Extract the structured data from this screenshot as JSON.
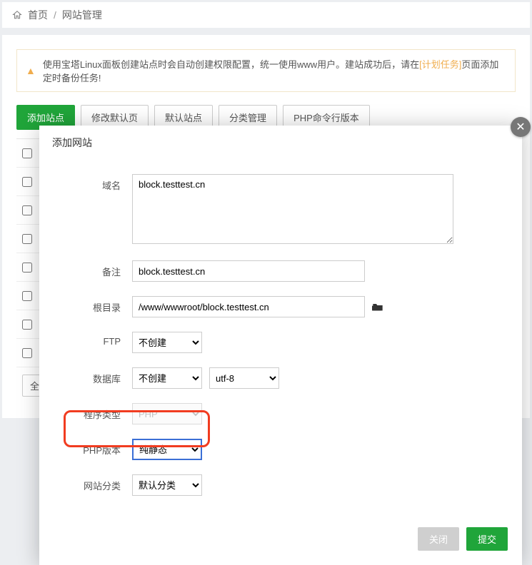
{
  "breadcrumb": {
    "home": "首页",
    "current": "网站管理"
  },
  "alert": {
    "prefix": "使用宝塔Linux面板创建站点时会自动创建权限配置，统一使用www用户。建站成功后，请在",
    "link": "[计划任务]",
    "suffix": "页面添加定时备份任务!"
  },
  "toolbar": {
    "add": "添加站点",
    "modify_default": "修改默认页",
    "default_site": "默认站点",
    "category": "分类管理",
    "php_cli": "PHP命令行版本"
  },
  "list_footer": "全部",
  "modal": {
    "title": "添加网站",
    "labels": {
      "domain": "域名",
      "remark": "备注",
      "root": "根目录",
      "ftp": "FTP",
      "database": "数据库",
      "program": "程序类型",
      "php": "PHP版本",
      "category": "网站分类"
    },
    "values": {
      "domain": "block.testtest.cn",
      "remark": "block.testtest.cn",
      "root": "/www/wwwroot/block.testtest.cn",
      "ftp": "不创建",
      "database": "不创建",
      "charset": "utf-8",
      "program": "PHP",
      "php": "纯静态",
      "category": "默认分类"
    },
    "buttons": {
      "close": "关闭",
      "submit": "提交"
    }
  }
}
